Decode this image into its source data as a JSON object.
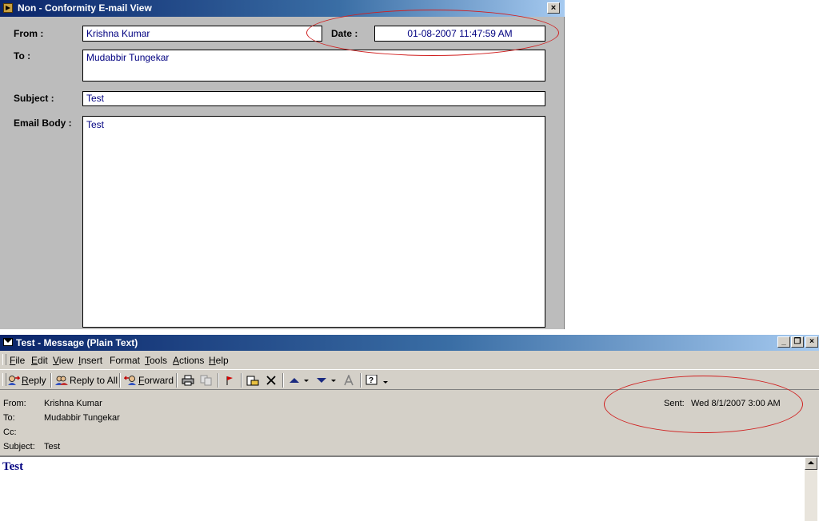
{
  "top_window": {
    "title": "Non - Conformity E-mail View",
    "close_label": "×",
    "from_label": "From :",
    "from_value": "Krishna Kumar",
    "date_label": "Date :",
    "date_value": "01-08-2007 11:47:59 AM",
    "to_label": "To :",
    "to_value": "Mudabbir Tungekar",
    "subject_label": "Subject :",
    "subject_value": "Test",
    "body_label": "Email Body :",
    "body_value": "Test"
  },
  "message_window": {
    "title": "Test - Message (Plain Text)",
    "window_buttons": {
      "minimize": "_",
      "restore": "❐",
      "close": "×"
    },
    "menu": [
      {
        "u": "F",
        "rest": "ile"
      },
      {
        "u": "E",
        "rest": "dit"
      },
      {
        "u": "V",
        "rest": "iew"
      },
      {
        "u": "I",
        "rest": "nsert"
      },
      {
        "u": "",
        "rest": "Format"
      },
      {
        "u": "T",
        "rest": "ools"
      },
      {
        "u": "A",
        "rest": "ctions"
      },
      {
        "u": "H",
        "rest": "elp"
      }
    ],
    "toolbar": {
      "reply_u": "R",
      "reply_rest": "eply",
      "reply_all": "Reply to All",
      "forward_u": "F",
      "forward_rest": "orward"
    },
    "header": {
      "from_label": "From:",
      "from_value": "Krishna Kumar",
      "to_label": "To:",
      "to_value": "Mudabbir Tungekar",
      "cc_label": "Cc:",
      "cc_value": "",
      "subject_label": "Subject:",
      "subject_value": "Test",
      "sent_label": "Sent:",
      "sent_value": "Wed 8/1/2007 3:00 AM"
    },
    "body": "Test"
  },
  "colors": {
    "annotation": "#d02020",
    "field_text": "#000080",
    "title_bar": "#0a246a"
  }
}
